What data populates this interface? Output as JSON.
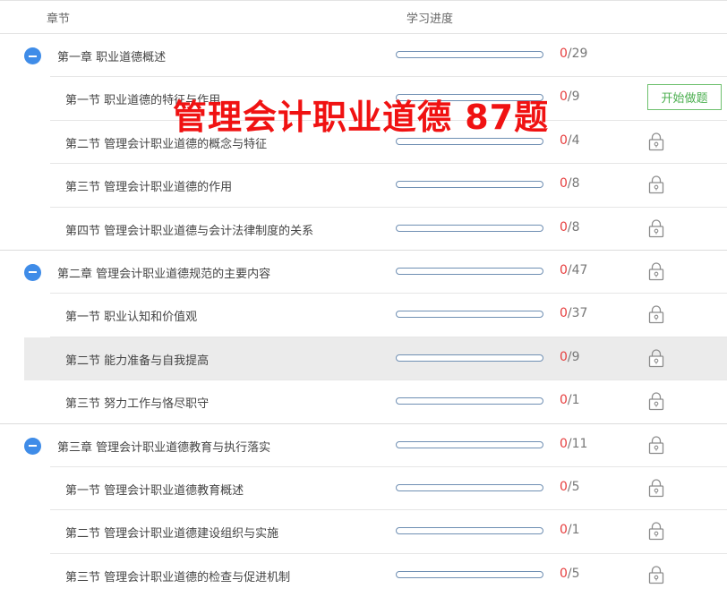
{
  "header": {
    "chapter_col": "章节",
    "progress_col": "学习进度"
  },
  "overlay_text": "管理会计职业道德 87题",
  "start_button_label": "开始做题",
  "rows": [
    {
      "type": "chapter",
      "title": "第一章 职业道德概述",
      "done": "0",
      "total": "/29",
      "progress": 0
    },
    {
      "type": "section",
      "title": "第一节 职业道德的特征与作用",
      "done": "0",
      "total": "/9",
      "progress": 0,
      "action": "start"
    },
    {
      "type": "section",
      "title": "第二节 管理会计职业道德的概念与特征",
      "done": "0",
      "total": "/4",
      "progress": 0,
      "action": "lock"
    },
    {
      "type": "section",
      "title": "第三节 管理会计职业道德的作用",
      "done": "0",
      "total": "/8",
      "progress": 0,
      "action": "lock"
    },
    {
      "type": "section",
      "title": "第四节 管理会计职业道德与会计法律制度的关系",
      "done": "0",
      "total": "/8",
      "progress": 0,
      "action": "lock"
    },
    {
      "type": "chapter",
      "title": "第二章 管理会计职业道德规范的主要内容",
      "done": "0",
      "total": "/47",
      "progress": 0,
      "action": "lock"
    },
    {
      "type": "section",
      "title": "第一节 职业认知和价值观",
      "done": "0",
      "total": "/37",
      "progress": 0,
      "action": "lock"
    },
    {
      "type": "section",
      "title": "第二节 能力准备与自我提高",
      "done": "0",
      "total": "/9",
      "progress": 0,
      "action": "lock",
      "highlighted": true
    },
    {
      "type": "section",
      "title": "第三节 努力工作与恪尽职守",
      "done": "0",
      "total": "/1",
      "progress": 0,
      "action": "lock"
    },
    {
      "type": "chapter",
      "title": "第三章 管理会计职业道德教育与执行落实",
      "done": "0",
      "total": "/11",
      "progress": 0,
      "action": "lock"
    },
    {
      "type": "section",
      "title": "第一节 管理会计职业道德教育概述",
      "done": "0",
      "total": "/5",
      "progress": 0,
      "action": "lock"
    },
    {
      "type": "section",
      "title": "第二节 管理会计职业道德建设组织与实施",
      "done": "0",
      "total": "/1",
      "progress": 0,
      "action": "lock"
    },
    {
      "type": "section",
      "title": "第三节 管理会计职业道德的检查与促进机制",
      "done": "0",
      "total": "/5",
      "progress": 0,
      "action": "lock"
    }
  ]
}
